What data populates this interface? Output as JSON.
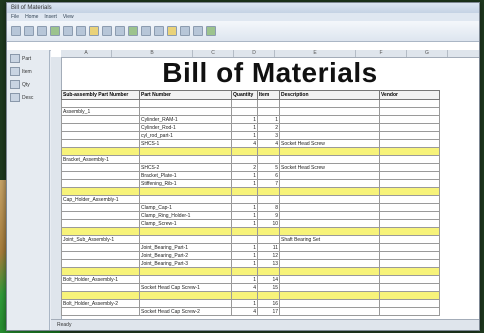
{
  "window": {
    "title": "Bill of Materials"
  },
  "ribbon_tabs": [
    "File",
    "Home",
    "Insert",
    "View"
  ],
  "sidebar": {
    "items": [
      {
        "label": "Part"
      },
      {
        "label": "Item"
      },
      {
        "label": "Qty"
      },
      {
        "label": "Desc"
      }
    ]
  },
  "sheet": {
    "title": "Bill of Materials"
  },
  "columns": [
    "A",
    "B",
    "C",
    "D",
    "E",
    "F",
    "G"
  ],
  "table": {
    "headers": [
      "Sub-assembly Part Number",
      "Part Number",
      "Quantity",
      "Item",
      "Description",
      "Vendor"
    ],
    "rows": [
      {
        "hl": false,
        "cells": [
          "",
          "",
          "",
          "",
          "",
          ""
        ]
      },
      {
        "hl": false,
        "cells": [
          "Assembly_1",
          "",
          "",
          "",
          "",
          ""
        ]
      },
      {
        "hl": false,
        "cells": [
          "",
          "Cylinder_RAM-1",
          "1",
          "1",
          "",
          ""
        ]
      },
      {
        "hl": false,
        "cells": [
          "",
          "Cylinder_Rod-1",
          "1",
          "2",
          "",
          ""
        ]
      },
      {
        "hl": false,
        "cells": [
          "",
          "cyl_rod_part-1",
          "1",
          "3",
          "",
          ""
        ]
      },
      {
        "hl": false,
        "cells": [
          "",
          "SHCS-1",
          "4",
          "4",
          "Socket Head Screw",
          ""
        ]
      },
      {
        "hl": true,
        "cells": [
          "",
          "",
          "",
          "",
          "",
          ""
        ]
      },
      {
        "hl": false,
        "cells": [
          "Bracket_Assembly-1",
          "",
          "",
          "",
          "",
          ""
        ]
      },
      {
        "hl": false,
        "cells": [
          "",
          "SHCS-2",
          "2",
          "5",
          "Socket Head Screw",
          ""
        ]
      },
      {
        "hl": false,
        "cells": [
          "",
          "Bracket_Plate-1",
          "1",
          "6",
          "",
          ""
        ]
      },
      {
        "hl": false,
        "cells": [
          "",
          "Stiffening_Rib-1",
          "1",
          "7",
          "",
          ""
        ]
      },
      {
        "hl": true,
        "cells": [
          "",
          "",
          "",
          "",
          "",
          ""
        ]
      },
      {
        "hl": false,
        "cells": [
          "Cap_Holder_Assembly-1",
          "",
          "",
          "",
          "",
          ""
        ]
      },
      {
        "hl": false,
        "cells": [
          "",
          "Clamp_Cap-1",
          "1",
          "8",
          "",
          ""
        ]
      },
      {
        "hl": false,
        "cells": [
          "",
          "Clamp_Ring_Holder-1",
          "1",
          "9",
          "",
          ""
        ]
      },
      {
        "hl": false,
        "cells": [
          "",
          "Clamp_Screw-1",
          "1",
          "10",
          "",
          ""
        ]
      },
      {
        "hl": true,
        "cells": [
          "",
          "",
          "",
          "",
          "",
          ""
        ]
      },
      {
        "hl": false,
        "cells": [
          "Joint_Sub_Assembly-1",
          "",
          "",
          "",
          "Shaft Bearing Set",
          ""
        ]
      },
      {
        "hl": false,
        "cells": [
          "",
          "Joint_Bearing_Part-1",
          "1",
          "11",
          "",
          ""
        ]
      },
      {
        "hl": false,
        "cells": [
          "",
          "Joint_Bearing_Part-2",
          "1",
          "12",
          "",
          ""
        ]
      },
      {
        "hl": false,
        "cells": [
          "",
          "Joint_Bearing_Part-3",
          "1",
          "13",
          "",
          ""
        ]
      },
      {
        "hl": true,
        "cells": [
          "",
          "",
          "",
          "",
          "",
          ""
        ]
      },
      {
        "hl": false,
        "cells": [
          "Bolt_Holder_Assembly-1",
          "",
          "1",
          "14",
          "",
          ""
        ]
      },
      {
        "hl": false,
        "cells": [
          "",
          "Socket Head Cap Screw-1",
          "4",
          "15",
          "",
          ""
        ]
      },
      {
        "hl": true,
        "cells": [
          "",
          "",
          "",
          "",
          "",
          ""
        ]
      },
      {
        "hl": false,
        "cells": [
          "Bolt_Holder_Assembly-2",
          "",
          "1",
          "16",
          "",
          ""
        ]
      },
      {
        "hl": false,
        "cells": [
          "",
          "Socket Head Cap Screw-2",
          "4",
          "17",
          "",
          ""
        ]
      }
    ]
  },
  "status": {
    "text": "Ready"
  }
}
